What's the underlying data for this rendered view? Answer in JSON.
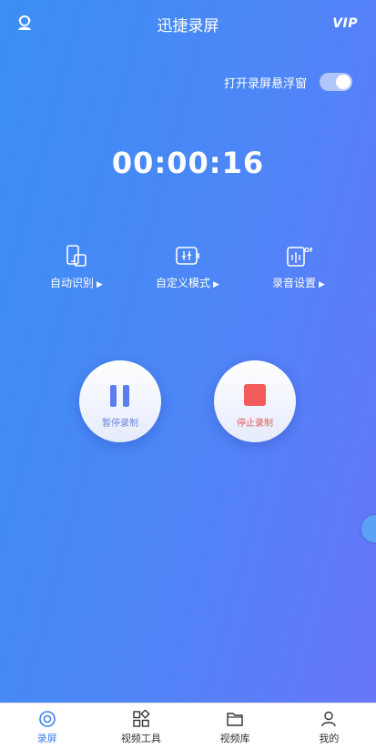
{
  "header": {
    "title": "迅捷录屏",
    "vip": "VIP"
  },
  "floating": {
    "label": "打开录屏悬浮窗",
    "enabled": true
  },
  "timer": "00:00:16",
  "tools": [
    {
      "label": "自动识别",
      "icon": "phone-rotate-icon"
    },
    {
      "label": "自定义模式",
      "icon": "sliders-icon"
    },
    {
      "label": "录音设置",
      "icon": "audio-on-icon"
    }
  ],
  "arrow": "▶",
  "controls": {
    "pause_label": "暂停录制",
    "stop_label": "停止录制"
  },
  "tabs": [
    {
      "label": "录屏",
      "icon": "record-icon",
      "active": true
    },
    {
      "label": "视频工具",
      "icon": "grid-tools-icon",
      "active": false
    },
    {
      "label": "视频库",
      "icon": "folder-icon",
      "active": false
    },
    {
      "label": "我的",
      "icon": "profile-icon",
      "active": false
    }
  ],
  "colors": {
    "gradient_start": "#3b8ff5",
    "gradient_end": "#6876fa",
    "stop_red": "#f25b59",
    "pause_blue": "#5a7ef0",
    "tab_active": "#3b82f0"
  }
}
